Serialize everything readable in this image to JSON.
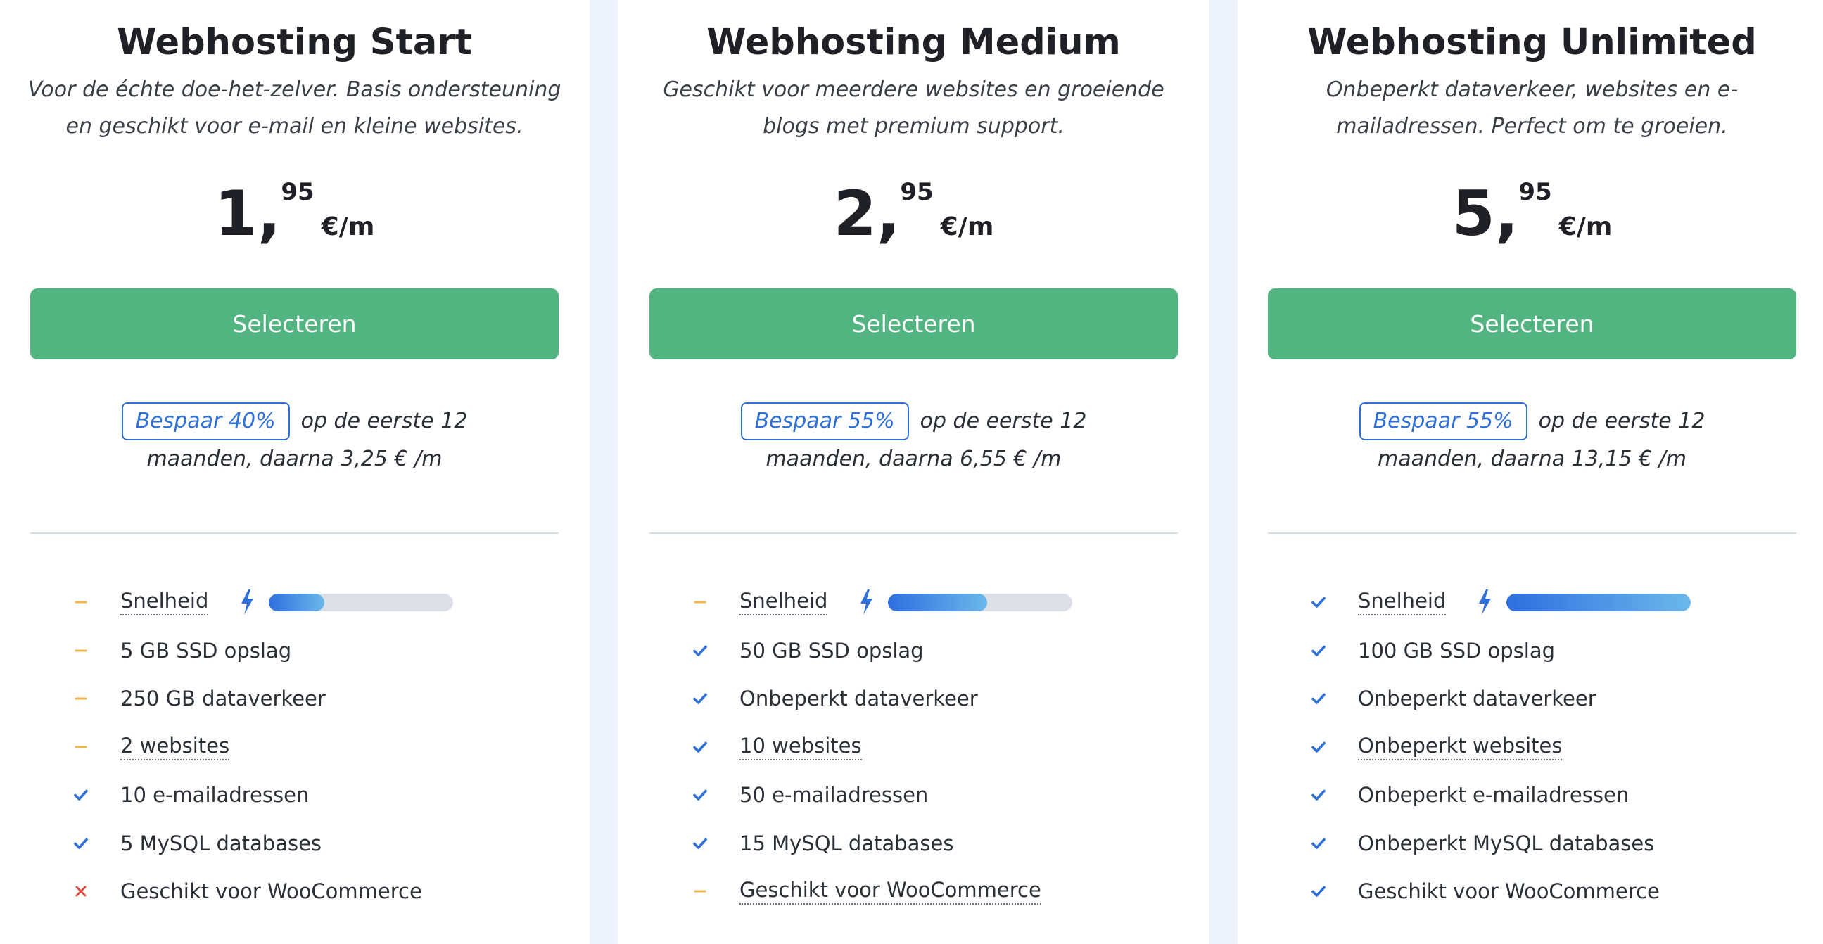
{
  "plans": [
    {
      "title": "Webhosting Start",
      "description_line1": "Voor de échte doe-het-zelver. Basis ondersteuning",
      "description_line2": "en geschikt voor e-mail en kleine websites.",
      "price_int": "1,",
      "price_cents": "95",
      "price_unit": "€/m",
      "button_label": "Selecteren",
      "badge": "Bespaar 40%",
      "promo_line1": "op de eerste 12",
      "promo_line2": "maanden, daarna 3,25 € /m",
      "speed_level": 0.3,
      "features": [
        {
          "label": "Snelheid",
          "status": "partial"
        },
        {
          "label": "5 GB SSD opslag",
          "status": "partial"
        },
        {
          "label": "250 GB dataverkeer",
          "status": "partial"
        },
        {
          "label": "2 websites",
          "status": "partial"
        },
        {
          "label": "10 e-mailadressen",
          "status": "check"
        },
        {
          "label": "5 MySQL databases",
          "status": "check"
        },
        {
          "label": "Geschikt voor WooCommerce",
          "status": "cross"
        }
      ]
    },
    {
      "title": "Webhosting Medium",
      "description_line1": "Geschikt voor meerdere websites en groeiende",
      "description_line2": "blogs met premium support.",
      "price_int": "2,",
      "price_cents": "95",
      "price_unit": "€/m",
      "button_label": "Selecteren",
      "badge": "Bespaar 55%",
      "promo_line1": "op de eerste 12",
      "promo_line2": "maanden, daarna 6,55 € /m",
      "speed_level": 0.54,
      "features": [
        {
          "label": "Snelheid",
          "status": "partial"
        },
        {
          "label": "50 GB SSD opslag",
          "status": "check"
        },
        {
          "label": "Onbeperkt dataverkeer",
          "status": "check"
        },
        {
          "label": "10 websites",
          "status": "check"
        },
        {
          "label": "50 e-mailadressen",
          "status": "check"
        },
        {
          "label": "15 MySQL databases",
          "status": "check"
        },
        {
          "label": "Geschikt voor WooCommerce",
          "status": "partial"
        }
      ]
    },
    {
      "title": "Webhosting Unlimited",
      "description_line1": "Onbeperkt dataverkeer, websites en e-",
      "description_line2": "mailadressen. Perfect om te groeien.",
      "price_int": "5,",
      "price_cents": "95",
      "price_unit": "€/m",
      "button_label": "Selecteren",
      "badge": "Bespaar 55%",
      "promo_line1": "op de eerste 12",
      "promo_line2": "maanden, daarna 13,15 € /m",
      "speed_level": 1.0,
      "features": [
        {
          "label": "Snelheid",
          "status": "check"
        },
        {
          "label": "100 GB SSD opslag",
          "status": "check"
        },
        {
          "label": "Onbeperkt dataverkeer",
          "status": "check"
        },
        {
          "label": "Onbeperkt websites",
          "status": "check"
        },
        {
          "label": "Onbeperkt e-mailadressen",
          "status": "check"
        },
        {
          "label": "Onbeperkt MySQL databases",
          "status": "check"
        },
        {
          "label": "Geschikt voor WooCommerce",
          "status": "check"
        }
      ]
    }
  ],
  "colors": {
    "accent_green": "#52b581",
    "accent_blue": "#2e6fd8",
    "partial_orange": "#f0b64a",
    "cross_red": "#e0453a"
  }
}
